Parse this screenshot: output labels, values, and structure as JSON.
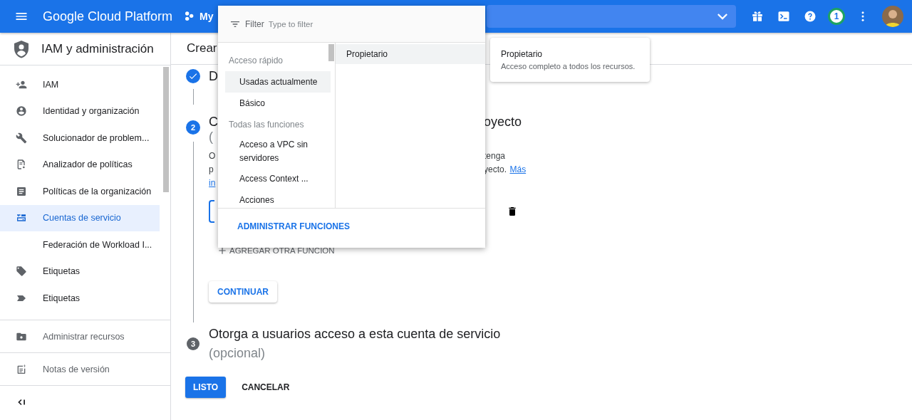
{
  "topbar": {
    "title": "Google Cloud Platform",
    "project": "My",
    "notifications": "1"
  },
  "sidebar": {
    "title": "IAM y administración",
    "items": [
      {
        "label": "IAM",
        "selected": false
      },
      {
        "label": "Identidad y organización",
        "selected": false
      },
      {
        "label": "Solucionador de problem...",
        "selected": false
      },
      {
        "label": "Analizador de políticas",
        "selected": false
      },
      {
        "label": "Políticas de la organización",
        "selected": false
      },
      {
        "label": "Cuentas de servicio",
        "selected": true
      },
      {
        "label": "Federación de Workload I...",
        "selected": false
      },
      {
        "label": "Etiquetas",
        "selected": false
      },
      {
        "label": "Etiquetas",
        "selected": false
      }
    ],
    "footer_items": [
      {
        "label": "Administrar recursos"
      },
      {
        "label": "Notas de versión"
      }
    ]
  },
  "page": {
    "title": "Crear",
    "step1": {
      "kind": "done",
      "title": "D"
    },
    "step2": {
      "kind": "active",
      "number": "2",
      "title_left": "C",
      "title_right": "oyecto",
      "subtitle": "(",
      "description": [
        {
          "left": "O",
          "right": "tenga"
        },
        {
          "left": "p",
          "right": "yecto.",
          "link": "Más"
        },
        {
          "link_left": "in"
        }
      ],
      "add_role": "AGREGAR OTRA FUNCIÓN",
      "continue": "CONTINUAR"
    },
    "step3": {
      "kind": "pending",
      "number": "3",
      "title": "Otorga a usuarios acceso a esta cuenta de servicio",
      "subtitle": "(opcional)"
    },
    "buttons": {
      "done": "LISTO",
      "cancel": "CANCELAR"
    }
  },
  "role_menu": {
    "filter_label": "Filter",
    "placeholder": "Type to filter",
    "groups": [
      {
        "header": "Acceso rápido",
        "items": [
          {
            "label": "Usadas actualmente",
            "selected": true
          },
          {
            "label": "Básico",
            "selected": false
          }
        ]
      },
      {
        "header": "Todas las funciones",
        "items": [
          {
            "label": "Acceso a VPC sin servidores",
            "selected": false
          },
          {
            "label": "Access Context ...",
            "selected": false
          },
          {
            "label": "Acciones",
            "selected": false
          }
        ]
      }
    ],
    "roles": [
      {
        "label": "Propietario",
        "selected": true
      }
    ],
    "manage": "ADMINISTRAR FUNCIONES"
  },
  "tooltip": {
    "title": "Propietario",
    "description": "Acceso completo a todos los recursos."
  }
}
